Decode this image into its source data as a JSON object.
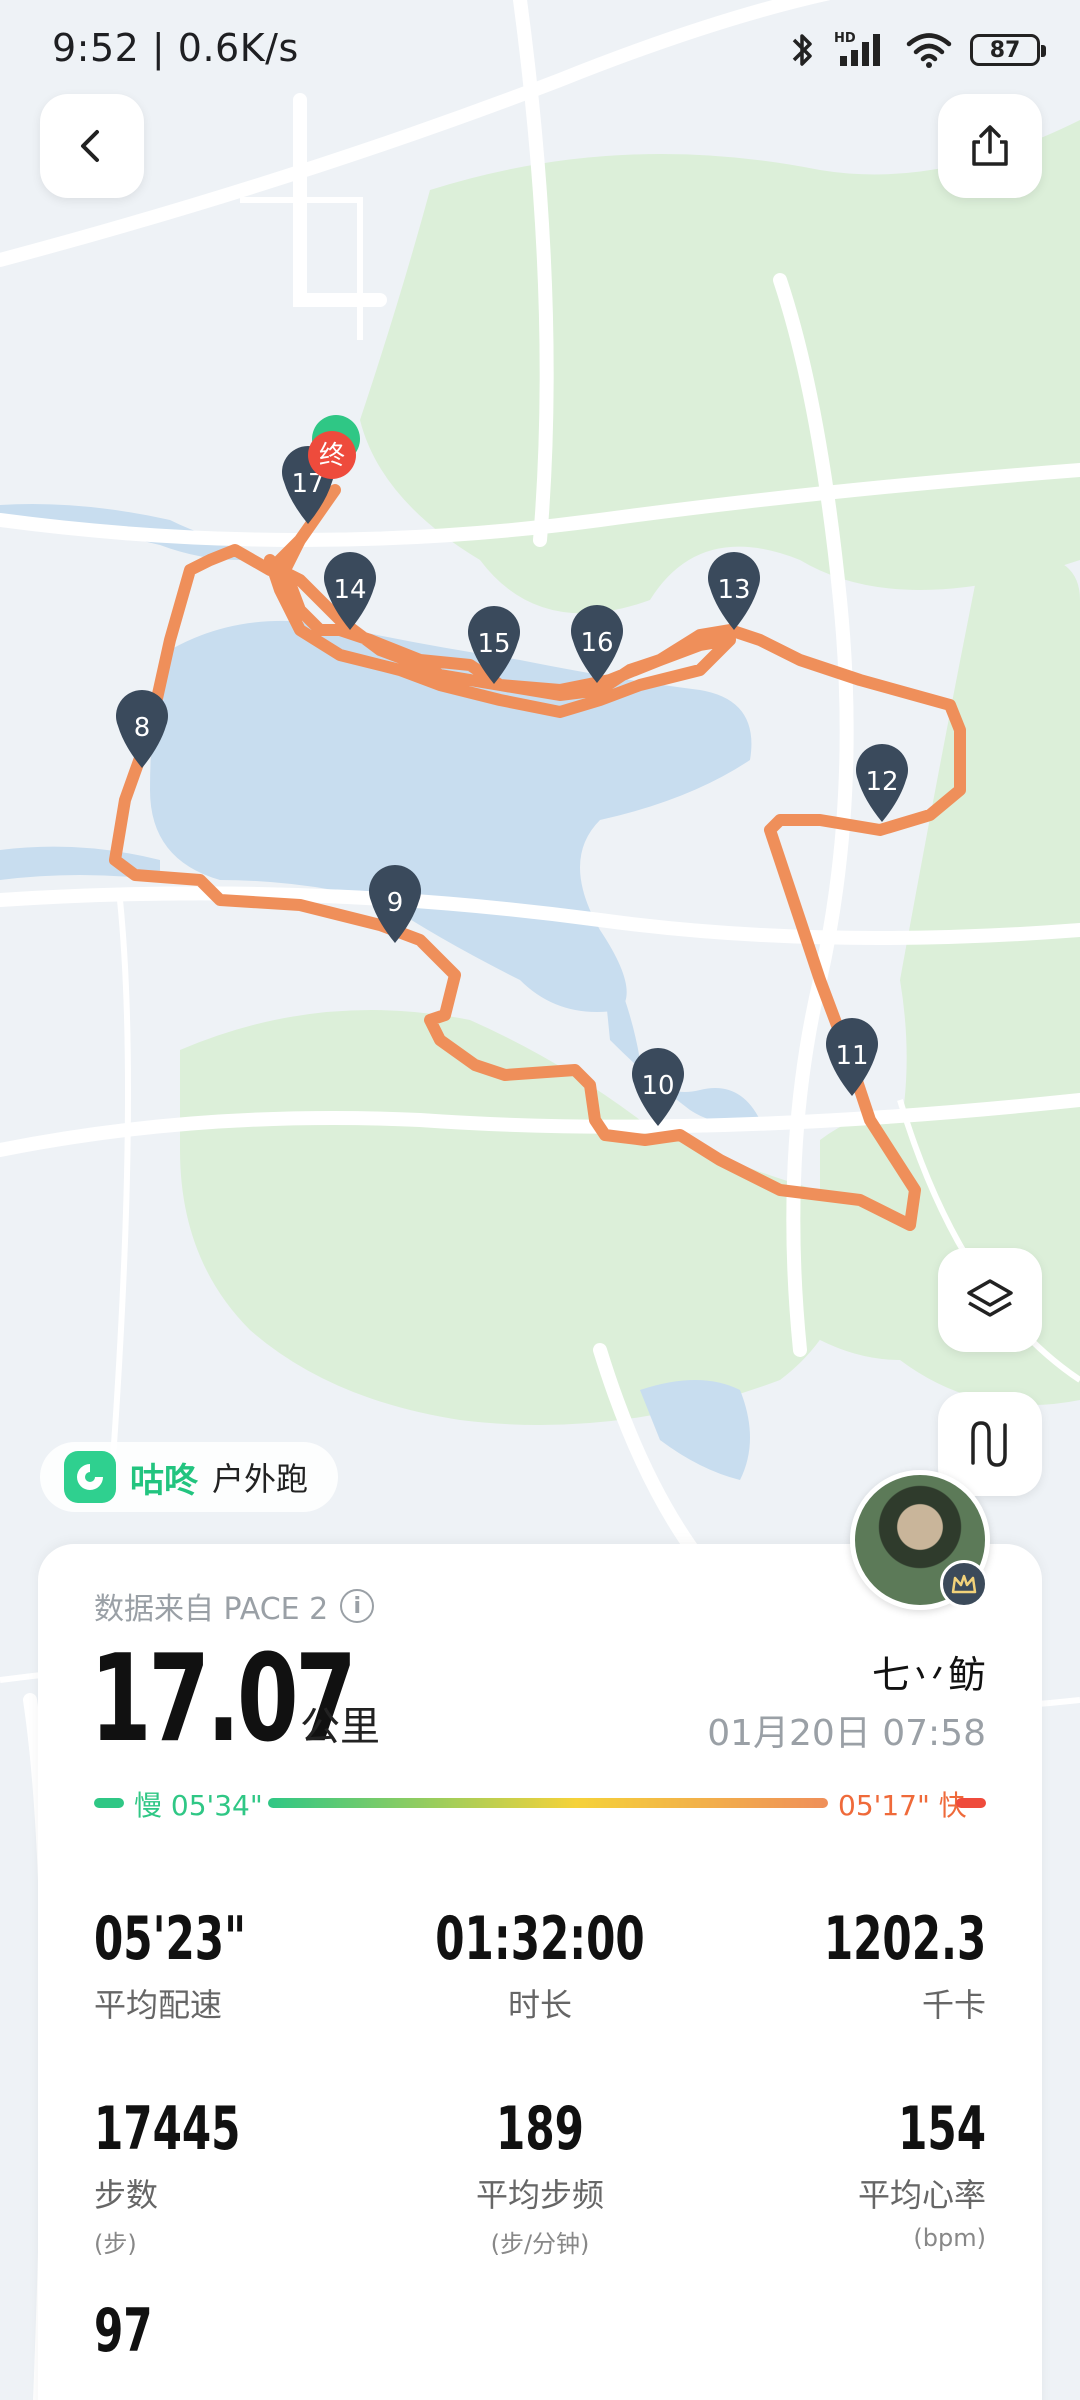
{
  "status_bar": {
    "time": "9:52 | 0.6K/s",
    "battery": "87"
  },
  "map": {
    "markers": [
      "8",
      "9",
      "10",
      "11",
      "12",
      "13",
      "14",
      "15",
      "16",
      "17"
    ],
    "end_marker": "终",
    "route_color": "#ef8f5a"
  },
  "app": {
    "name": "咕咚",
    "activity": "户外跑"
  },
  "card": {
    "source": "数据来自 PACE 2",
    "distance": "17.07",
    "distance_unit": "公里",
    "username": "七丷鲂",
    "date": "01月20日 07:58",
    "pace_bar": {
      "slow_label": "慢 05'34\"",
      "fast_label": "05'17\" 快"
    },
    "stats": [
      {
        "value": "05'23\"",
        "label": "平均配速",
        "sub": ""
      },
      {
        "value": "01:32:00",
        "label": "时长",
        "sub": ""
      },
      {
        "value": "1202.3",
        "label": "千卡",
        "sub": ""
      },
      {
        "value": "17445",
        "label": "步数",
        "sub": "(步)"
      },
      {
        "value": "189",
        "label": "平均步频",
        "sub": "(步/分钟)"
      },
      {
        "value": "154",
        "label": "平均心率",
        "sub": "(bpm)"
      },
      {
        "value": "97",
        "label": "",
        "sub": ""
      }
    ]
  }
}
